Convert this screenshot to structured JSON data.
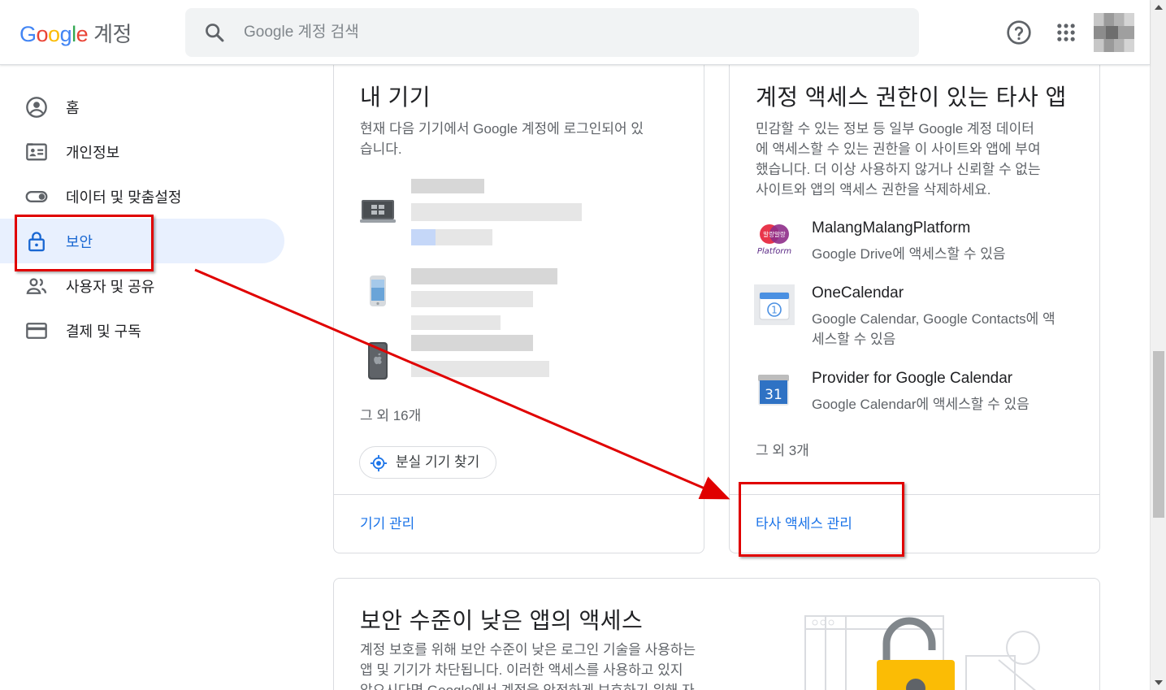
{
  "header": {
    "logo_letters": [
      "G",
      "o",
      "o",
      "g",
      "l",
      "e"
    ],
    "logo_suffix": "계정",
    "search_placeholder": "Google 계정 검색",
    "help_icon": "help-icon",
    "apps_icon": "apps-grid-icon"
  },
  "sidebar": {
    "items": [
      {
        "label": "홈",
        "icon": "account-circle-icon"
      },
      {
        "label": "개인정보",
        "icon": "id-card-icon"
      },
      {
        "label": "데이터 및 맞춤설정",
        "icon": "toggle-icon"
      },
      {
        "label": "보안",
        "icon": "lock-icon",
        "active": true
      },
      {
        "label": "사용자 및 공유",
        "icon": "people-icon"
      },
      {
        "label": "결제 및 구독",
        "icon": "credit-card-icon"
      }
    ]
  },
  "devices_card": {
    "title": "내 기기",
    "description_lines": [
      "현재 다음 기기에서 Google 계정에 로그인되어 있",
      "습니다."
    ],
    "devices": [
      {
        "icon": "laptop-icon"
      },
      {
        "icon": "phone-icon"
      },
      {
        "icon": "iphone-icon"
      }
    ],
    "more": "그 외 16개",
    "find_button": "분실 기기 찾기",
    "link": "기기 관리"
  },
  "apps_card": {
    "title": "계정 액세스 권한이 있는 타사 앱",
    "description_lines": [
      "민감할 수 있는 정보 등 일부 Google 계정 데이터",
      "에 액세스할 수 있는 권한을 이 사이트와 앱에 부여",
      "했습니다. 더 이상 사용하지 않거나 신뢰할 수 없는",
      "사이트와 앱의 액세스 권한을 삭제하세요."
    ],
    "apps": [
      {
        "name": "MalangMalangPlatform",
        "access_lines": [
          "Google Drive에 액세스할 수 있음"
        ],
        "icon": "malang-logo-icon",
        "logo_text": "말랑말랑",
        "logo_sub": "Platform"
      },
      {
        "name": "OneCalendar",
        "access_lines": [
          "Google Calendar, Google Contacts에 액",
          "세스할 수 있음"
        ],
        "icon": "onecalendar-icon",
        "logo_text": "1"
      },
      {
        "name": "Provider for Google Calendar",
        "access_lines": [
          "Google Calendar에 액세스할 수 있음"
        ],
        "icon": "google-calendar-icon",
        "logo_text": "31"
      }
    ],
    "more": "그 외 3개",
    "link": "타사 액세스 관리"
  },
  "low_security_card": {
    "title": "보안 수준이 낮은 앱의 액세스",
    "description_lines": [
      "계정 보호를 위해 보안 수준이 낮은 로그인 기술을 사용하는",
      "앱 및 기기가 차단됩니다. 이러한 액세스를 사용하고 있지",
      "않으시다면 Google에서 계정을 안전하게 보호하기 위해 자"
    ]
  },
  "colors": {
    "accent": "#1a73e8",
    "active_bg": "#e8f0fe",
    "annotation": "#e00000",
    "lock_yellow": "#fbbc05"
  }
}
